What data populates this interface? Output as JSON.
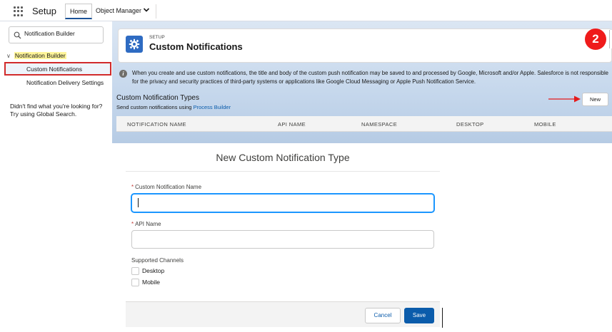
{
  "topbar": {
    "app_name": "Setup",
    "tabs": [
      {
        "label": "Home"
      },
      {
        "label": "Object Manager"
      }
    ]
  },
  "leftnav": {
    "search_value": "Notification Builder",
    "tree_root": "Notification Builder",
    "items": [
      {
        "label": "Custom Notifications",
        "selected": true
      },
      {
        "label": "Notification Delivery Settings"
      }
    ],
    "help_line1": "Didn't find what you're looking for?",
    "help_line2": "Try using Global Search."
  },
  "header": {
    "eyebrow": "SETUP",
    "title": "Custom Notifications",
    "step_badge": "2"
  },
  "info": {
    "text": "When you create and use custom notifications, the title and body of the custom push notification may be saved to and processed by Google, Microsoft and/or Apple. Salesforce is not responsible for the privacy and security practices of third-party systems or applications like Google Cloud Messaging or Apple Push Notification Service."
  },
  "types": {
    "title": "Custom Notification Types",
    "subtitle_prefix": "Send custom notifications using",
    "subtitle_link": "Process Builder",
    "new_button": "New",
    "columns": [
      "NOTIFICATION NAME",
      "API NAME",
      "NAMESPACE",
      "DESKTOP",
      "MOBILE"
    ]
  },
  "modal": {
    "title": "New Custom Notification Type",
    "name_label": "Custom Notification Name",
    "name_value": "",
    "api_label": "API Name",
    "api_value": "",
    "channels_label": "Supported Channels",
    "channels": [
      {
        "label": "Desktop",
        "checked": false
      },
      {
        "label": "Mobile",
        "checked": false
      }
    ],
    "cancel_label": "Cancel",
    "save_label": "Save"
  },
  "colors": {
    "brand": "#0b5cab",
    "highlight_border": "#d12b2b",
    "badge": "#ef1b1b",
    "search_highlight": "#fff59a"
  }
}
